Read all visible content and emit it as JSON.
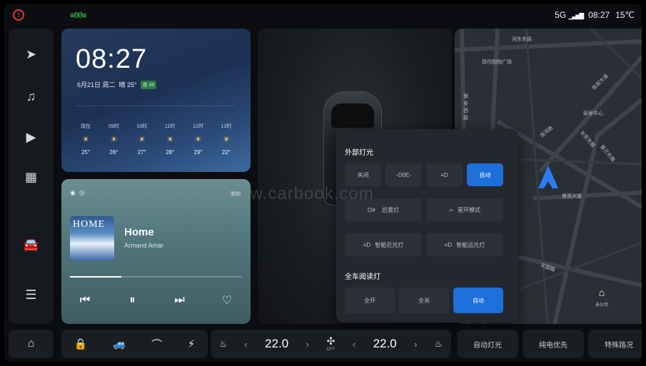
{
  "status_bar": {
    "left_icons": [
      "alert-circle-icon",
      "parking-lights-icon"
    ],
    "alert_glyph": "!",
    "lights_glyph": "≡00≡",
    "network": "5G",
    "signal": "▁▃▅▇",
    "time": "08:27",
    "temperature": "15℃"
  },
  "sidebar": {
    "items": [
      {
        "name": "navigation",
        "icon": "navigation-arrow-icon",
        "glyph": "➤"
      },
      {
        "name": "music",
        "icon": "music-note-icon",
        "glyph": "♫"
      },
      {
        "name": "video",
        "icon": "video-camera-icon",
        "glyph": "▶"
      },
      {
        "name": "apps",
        "icon": "app-grid-icon",
        "glyph": "▦"
      },
      {
        "name": "vehicle",
        "icon": "car-icon",
        "glyph": "🚘"
      },
      {
        "name": "settings",
        "icon": "toggle-settings-icon",
        "glyph": "☰"
      }
    ]
  },
  "weather": {
    "time": "08:27",
    "date": "6月21日 周二",
    "condition": "晴 25°",
    "aqi": "良 46",
    "hourly": [
      {
        "time": "现在",
        "temp": "25°"
      },
      {
        "time": "09时",
        "temp": "26°"
      },
      {
        "time": "10时",
        "temp": "27°"
      },
      {
        "time": "11时",
        "temp": "28°"
      },
      {
        "time": "12时",
        "temp": "29°"
      },
      {
        "time": "13时",
        "temp": "22°"
      }
    ],
    "sun_glyph": "☀"
  },
  "music": {
    "source_label": "酷狗",
    "album_title": "HOME",
    "song": "Home",
    "artist": "Armand Amar",
    "progress": 0.3,
    "controls": {
      "prev": "⏮",
      "pause": "⏸",
      "next": "⏭",
      "like": "♡"
    }
  },
  "map": {
    "labels": [
      "河东东路",
      "现代购物广场",
      "保安西路",
      "滨河路",
      "陈家大道",
      "长安东路",
      "研发中心",
      "景观大道",
      "花园路",
      "普兰东路"
    ],
    "home_label": "去公司",
    "home_glyph": "⌂"
  },
  "lights_panel": {
    "exterior_title": "外部灯光",
    "exterior_options": [
      {
        "label": "关闭",
        "active": false
      },
      {
        "label": "-D0E-",
        "active": false
      },
      {
        "label": "≡D",
        "active": false
      },
      {
        "label": "自动",
        "active": true
      }
    ],
    "fog_label": "后雾灯",
    "fog_glyph": "O≢",
    "ambient_label": "星环模式",
    "ambient_glyph": "⌓",
    "low_beam_label": "智能近光灯",
    "high_beam_label": "智能远光灯",
    "beam_glyph": "≡D",
    "reading_title": "全车阅读灯",
    "reading_options": [
      {
        "label": "全开",
        "active": false
      },
      {
        "label": "全关",
        "active": false
      },
      {
        "label": "自动",
        "active": true
      }
    ]
  },
  "dock": {
    "home_glyph": "⌂",
    "quick_glyphs": {
      "lock": "🔒",
      "vehicle": "🚙",
      "wiper": "⌒",
      "charge": "⚡"
    },
    "climate": {
      "driver_seat_glyph": "♨",
      "left_temp": "22.0",
      "right_temp": "22.0",
      "fan_glyph": "✣",
      "fan_state": "OFF",
      "passenger_seat_glyph": "♨",
      "chev_left": "‹",
      "chev_right": "›"
    },
    "pills": [
      "自动灯光",
      "纯电优先",
      "特殊路况"
    ]
  },
  "watermark": "www.carbook.com"
}
